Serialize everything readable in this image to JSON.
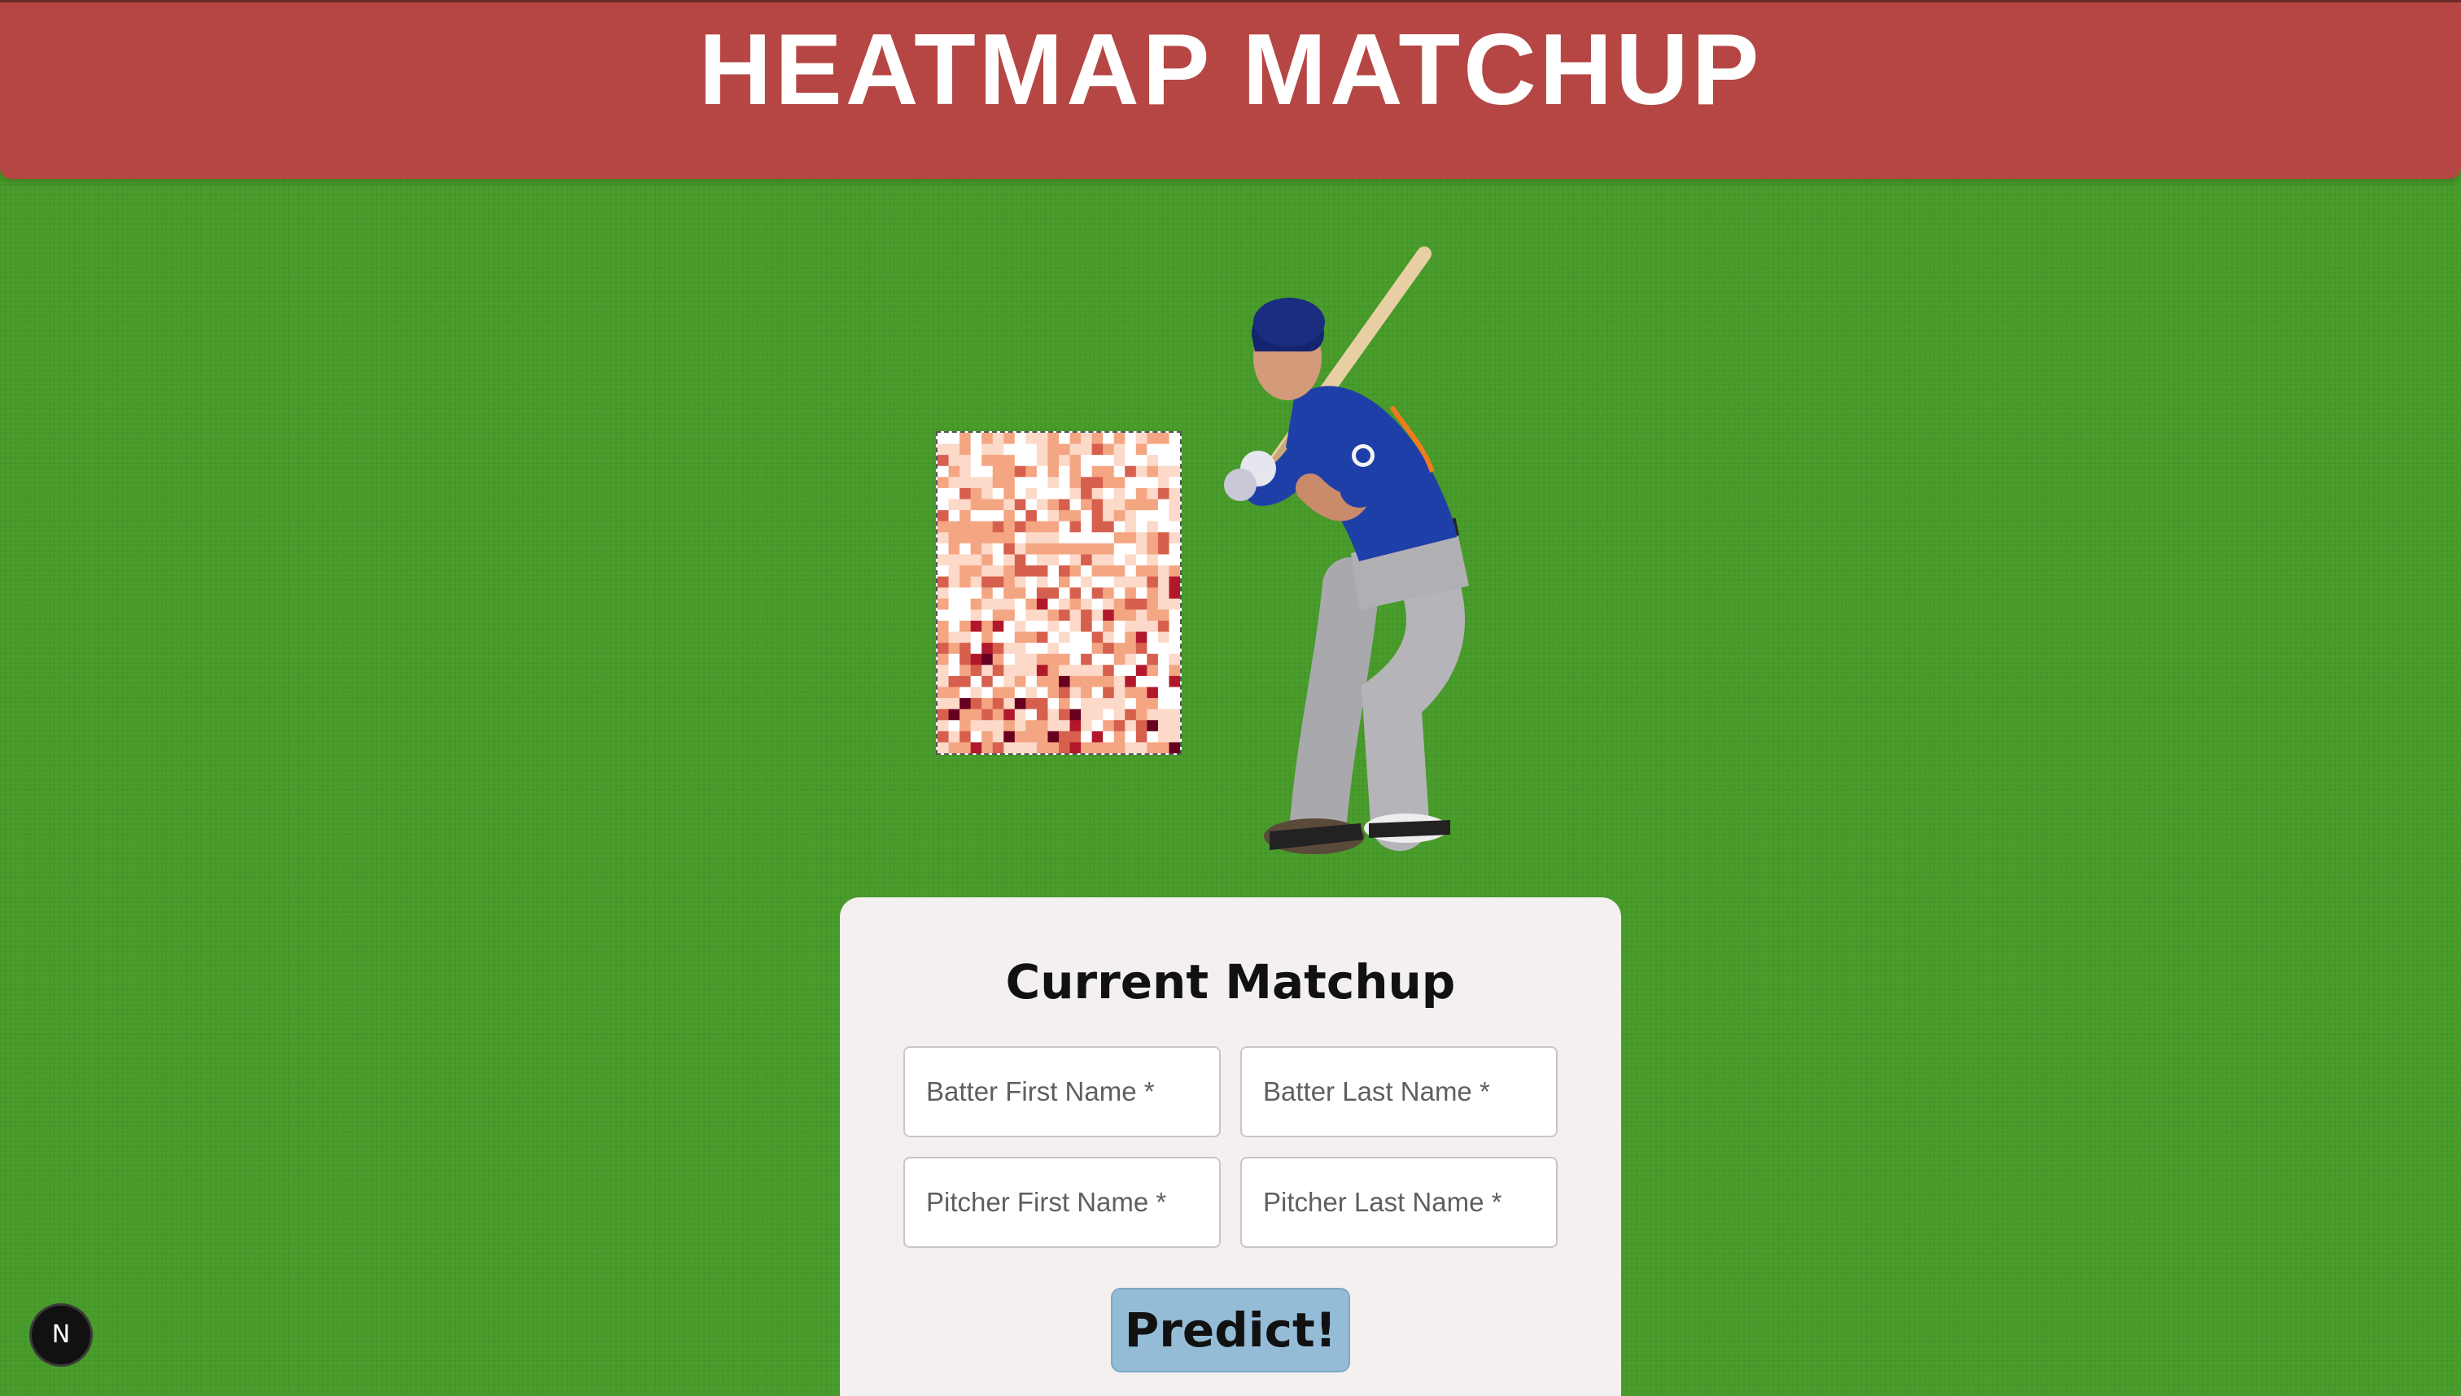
{
  "header": {
    "title": "HEATMAP MATCHUP",
    "background_color": "#b54644"
  },
  "heatmap": {
    "icon": "strike-zone-heatmap",
    "colorscale": [
      "#ffffff",
      "#fcd9c8",
      "#f4a582",
      "#d6604d",
      "#b2182b",
      "#67001f"
    ]
  },
  "batter_image": {
    "icon": "baseball-batter-image"
  },
  "form": {
    "title": "Current Matchup",
    "batter_first": {
      "placeholder": "Batter First Name *",
      "value": ""
    },
    "batter_last": {
      "placeholder": "Batter Last Name *",
      "value": ""
    },
    "pitcher_first": {
      "placeholder": "Pitcher First Name *",
      "value": ""
    },
    "pitcher_last": {
      "placeholder": "Pitcher Last Name *",
      "value": ""
    },
    "submit_label": "Predict!",
    "submit_color": "#94bcd6"
  },
  "dev_badge": {
    "label": "N"
  },
  "colors": {
    "field_green": "#4a9e2c",
    "card": "#f3f0ef"
  }
}
